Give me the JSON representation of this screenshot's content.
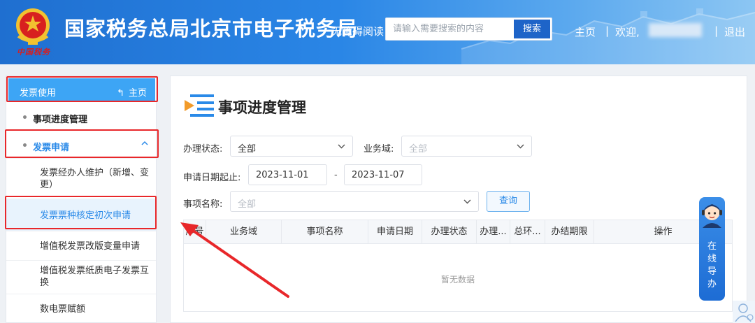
{
  "header": {
    "emblem_subtitle": "中国税务",
    "site_title": "国家税务总局北京市电子税务局",
    "accessibility": "无障碍阅读",
    "search_placeholder": "请输入需要搜索的内容",
    "search_button": "搜索",
    "nav_home": "主页",
    "nav_separator": "|",
    "nav_welcome": "欢迎,",
    "nav_logout": "退出"
  },
  "sidebar": {
    "title": "发票使用",
    "home": "主页",
    "items": [
      {
        "label": "事项进度管理"
      },
      {
        "label": "发票申请"
      }
    ],
    "sub_items": [
      {
        "label": "发票经办人维护（新增、变更）"
      },
      {
        "label": "发票票种核定初次申请"
      },
      {
        "label": "增值税发票改版变量申请"
      },
      {
        "label": "增值税发票纸质电子发票互换"
      },
      {
        "label": "数电票赋额"
      }
    ]
  },
  "main": {
    "title": "事项进度管理",
    "filters": {
      "status_label": "办理状态:",
      "status_value": "全部",
      "domain_label": "业务域:",
      "domain_placeholder": "全部",
      "date_label": "申请日期起止:",
      "date_start": "2023-11-01",
      "date_separator": "-",
      "date_end": "2023-11-07",
      "name_label": "事项名称:",
      "name_placeholder": "全部",
      "query_button": "查询"
    },
    "table": {
      "columns": [
        "序号",
        "业务域",
        "事项名称",
        "申请日期",
        "办理状态",
        "办理...",
        "总环...",
        "办结期限",
        "操作"
      ],
      "empty_text": "暂无数据"
    }
  },
  "guide": {
    "chars": [
      "在",
      "线",
      "导",
      "办"
    ]
  },
  "colors": {
    "header_blue": "#1f6fd0",
    "sidebar_accent": "#3da5f5",
    "highlight_red": "#e8272a",
    "link_blue": "#2a8ae8"
  }
}
